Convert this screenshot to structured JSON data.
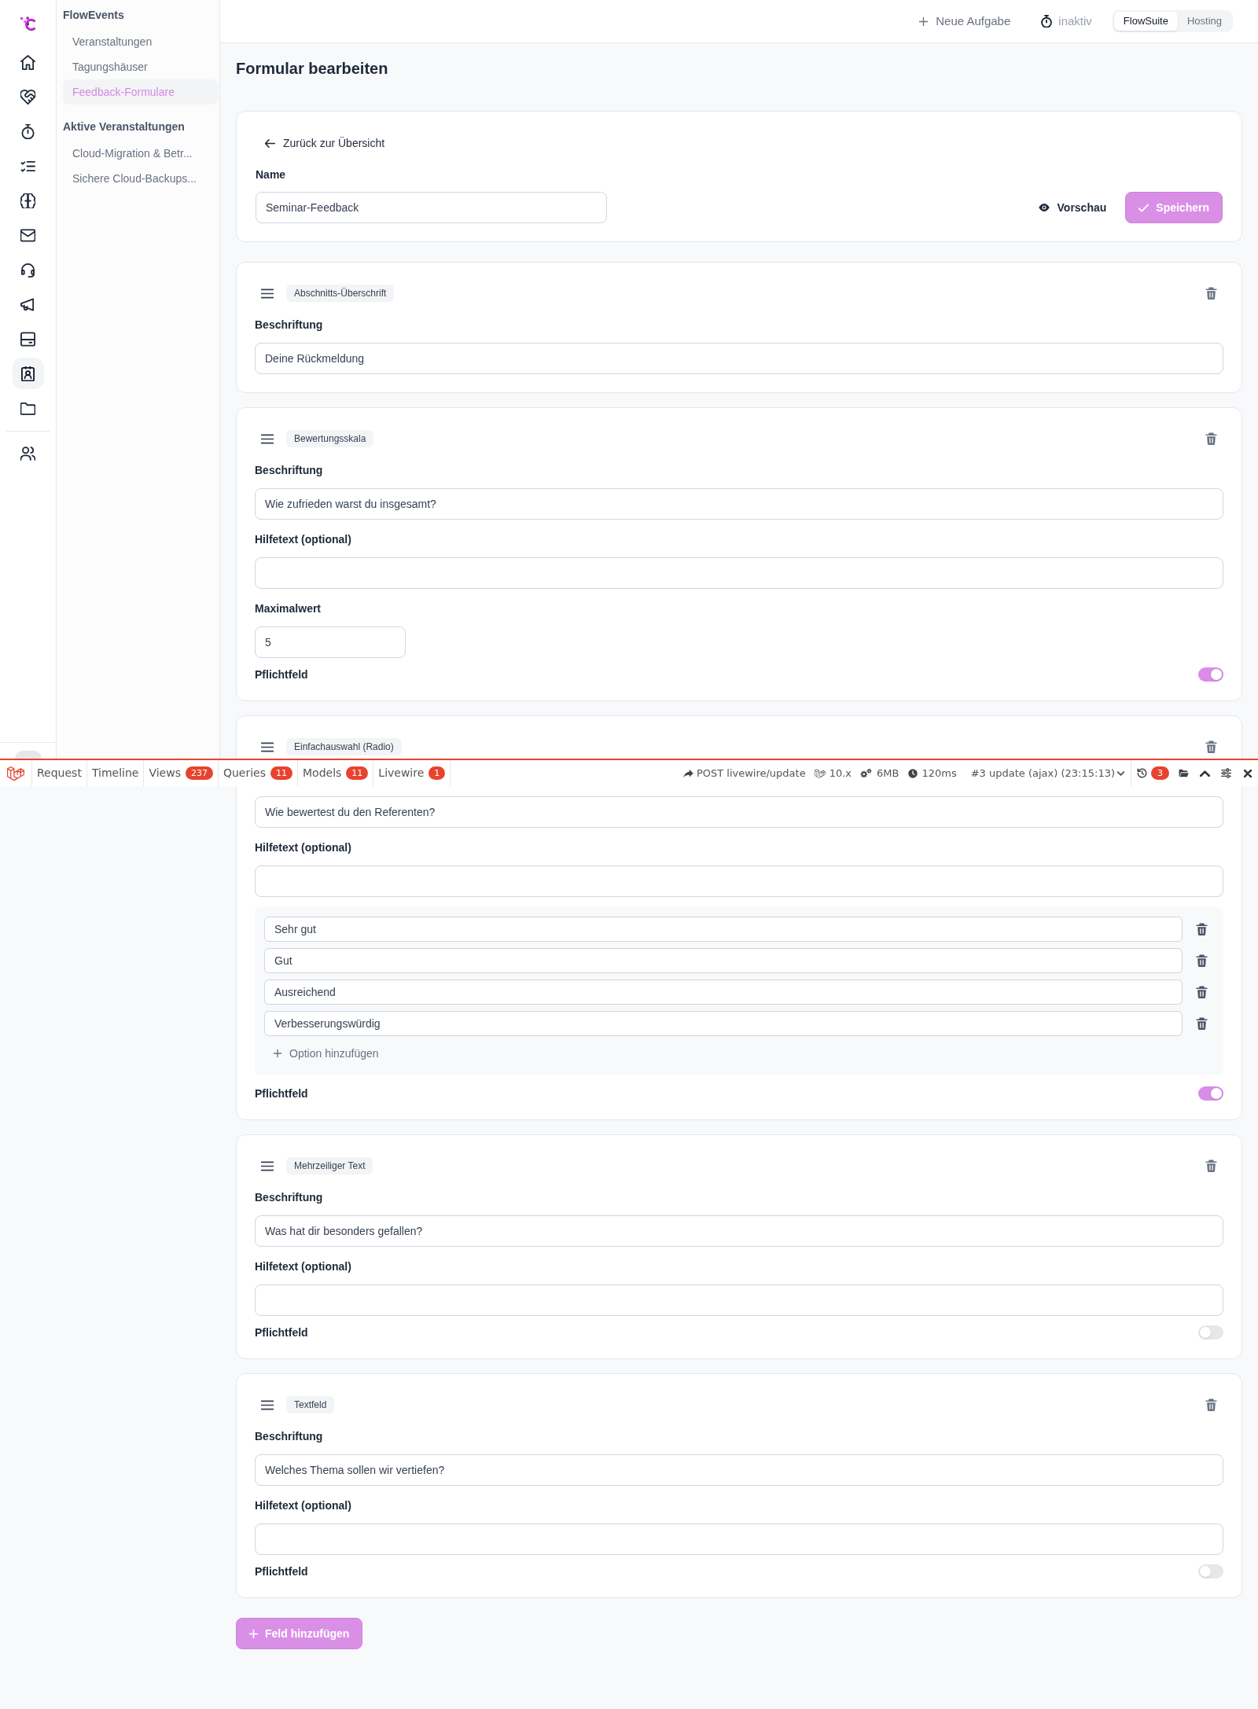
{
  "icon_rail": {
    "groups": [
      {
        "items": [
          {
            "selected": false
          },
          {
            "selected": false
          },
          {
            "selected": false
          },
          {
            "selected": false
          },
          {
            "selected": false
          },
          {
            "selected": false
          },
          {
            "selected": false
          },
          {
            "selected": false
          },
          {
            "selected": false
          },
          {
            "selected": true
          },
          {
            "selected": false
          }
        ]
      },
      {
        "items": [
          {
            "selected": false
          }
        ]
      }
    ]
  },
  "nav": {
    "groups": [
      {
        "title": "FlowEvents",
        "items": [
          {
            "label": "Veranstaltungen",
            "selected": false
          },
          {
            "label": "Tagungshäuser",
            "selected": false
          },
          {
            "label": "Feedback-Formulare",
            "selected": true
          }
        ]
      },
      {
        "title": "Aktive Veranstaltungen",
        "items": [
          {
            "label": "Cloud-Migration & Betr...",
            "selected": false
          },
          {
            "label": "Sichere Cloud-Backups...",
            "selected": false
          }
        ]
      }
    ]
  },
  "top_bar": {
    "new_task": "Neue Aufgabe",
    "timer": "inaktiv",
    "workspaces": [
      {
        "label": "FlowSuite",
        "selected": true
      },
      {
        "label": "Hosting",
        "selected": false
      }
    ]
  },
  "page_title": "Formular bearbeiten",
  "form": {
    "back_link": "Zurück zur Übersicht",
    "name_label": "Name",
    "name_value": "Seminar-Feedback",
    "preview_button": "Vorschau",
    "save_button": "Speichern"
  },
  "fields": [
    {
      "badge": "Abschnitts-Überschrift",
      "rows": [
        {
          "kind": "text",
          "label": "Beschriftung",
          "value": "Deine Rückmeldung"
        }
      ]
    },
    {
      "badge": "Bewertungsskala",
      "rows": [
        {
          "kind": "text",
          "label": "Beschriftung",
          "value": "Wie zufrieden warst du insgesamt?"
        },
        {
          "kind": "text",
          "label": "Hilfetext (optional)"
        },
        {
          "kind": "number",
          "label": "Maximalwert",
          "value": "5"
        },
        {
          "kind": "toggle",
          "label": "Pflichtfeld",
          "on": true
        }
      ]
    },
    {
      "badge": "Einfachauswahl (Radio)",
      "rows": [
        {
          "kind": "text",
          "value": "Wie bewertest du den Referenten?"
        },
        {
          "kind": "text",
          "label": "Hilfetext (optional)"
        },
        {
          "kind": "options",
          "options": [
            "Sehr gut",
            "Gut",
            "Ausreichend",
            "Verbesserungswürdig"
          ],
          "add_label": "Option hinzufügen"
        },
        {
          "kind": "toggle",
          "label": "Pflichtfeld",
          "on": true
        }
      ]
    },
    {
      "badge": "Mehrzeiliger Text",
      "rows": [
        {
          "kind": "text",
          "label": "Beschriftung",
          "value": "Was hat dir besonders gefallen?"
        },
        {
          "kind": "text",
          "label": "Hilfetext (optional)"
        },
        {
          "kind": "toggle",
          "label": "Pflichtfeld",
          "on": false
        }
      ]
    },
    {
      "badge": "Textfeld",
      "rows": [
        {
          "kind": "text",
          "label": "Beschriftung",
          "value": "Welches Thema sollen wir vertiefen?"
        },
        {
          "kind": "text",
          "label": "Hilfetext (optional)"
        },
        {
          "kind": "toggle",
          "label": "Pflichtfeld",
          "on": false
        }
      ]
    }
  ],
  "add_field_button": "Feld hinzufügen",
  "debug_bar": {
    "tabs": [
      {
        "label": "Request",
        "selected": false
      },
      {
        "label": "Timeline",
        "selected": false
      },
      {
        "label": "Views",
        "count": "237",
        "selected": false
      },
      {
        "label": "Queries",
        "count": "11",
        "selected": false
      },
      {
        "label": "Models",
        "count": "11",
        "selected": false
      },
      {
        "label": "Livewire",
        "count": "1",
        "selected": false
      }
    ],
    "request": "POST livewire/update",
    "version": "10.x",
    "memory": "6MB",
    "duration": "120ms",
    "current_request": "#3 update (ajax) (23:15:13)",
    "history_count": "3"
  }
}
